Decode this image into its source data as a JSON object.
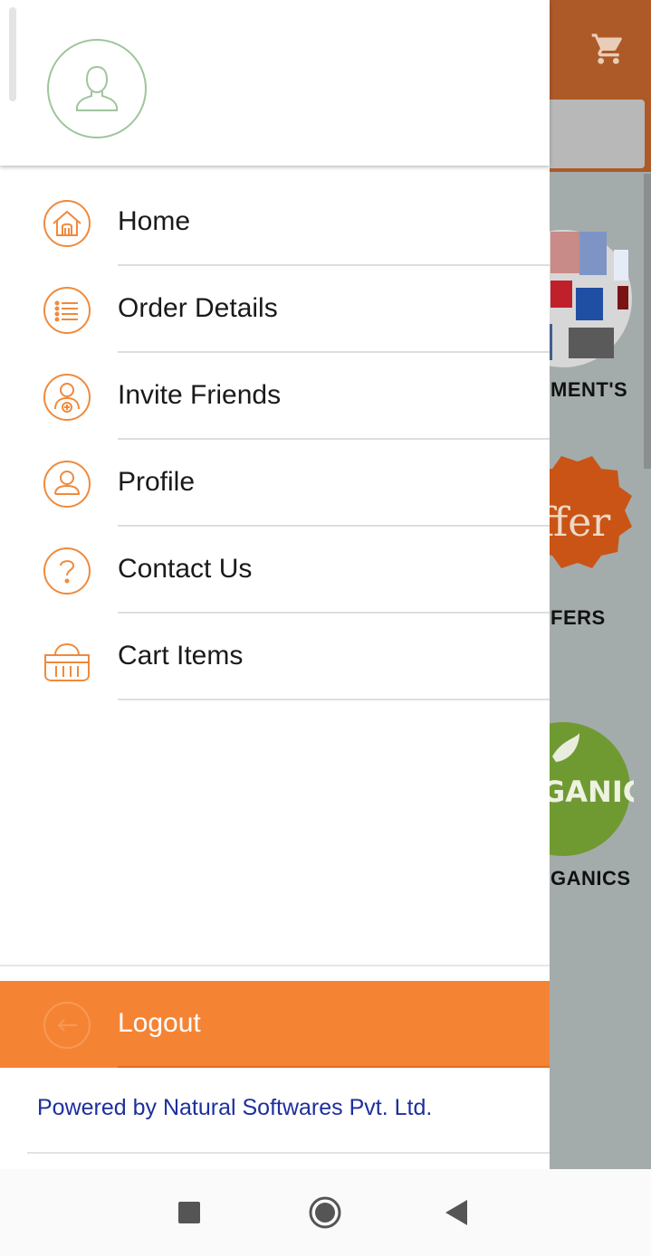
{
  "background": {
    "categories": [
      {
        "label": "MENT'S"
      },
      {
        "label": "FERS"
      },
      {
        "label": "GANICS"
      }
    ],
    "header_color": "#ad5a28",
    "icons": [
      "cart-icon"
    ]
  },
  "drawer": {
    "avatar_icon": "user-avatar-icon",
    "menu": [
      {
        "label": "Home",
        "icon": "home-icon"
      },
      {
        "label": "Order Details",
        "icon": "list-icon"
      },
      {
        "label": "Invite Friends",
        "icon": "add-user-icon"
      },
      {
        "label": "Profile",
        "icon": "user-icon"
      },
      {
        "label": "Contact Us",
        "icon": "question-icon"
      },
      {
        "label": "Cart Items",
        "icon": "basket-icon"
      }
    ],
    "logout_label": "Logout",
    "logout_icon": "logout-icon",
    "powered_by": "Powered by Natural Softwares Pvt. Ltd.",
    "accent_color": "#f48434",
    "powered_color": "#1d2f9c"
  },
  "system_nav": {
    "buttons": [
      "recents-square-icon",
      "home-circle-icon",
      "back-triangle-icon"
    ]
  }
}
